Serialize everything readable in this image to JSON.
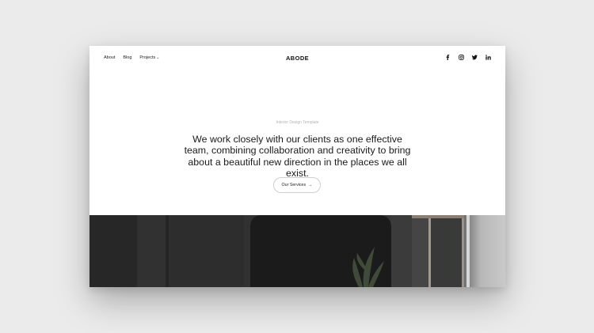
{
  "nav": {
    "items": [
      {
        "label": "About"
      },
      {
        "label": "Blog"
      },
      {
        "label": "Projects"
      }
    ],
    "projects_chevron": "chevron-down-icon",
    "logo": "ABODE",
    "socials": [
      "facebook-icon",
      "instagram-icon",
      "twitter-icon",
      "linkedin-icon"
    ]
  },
  "hero": {
    "eyebrow": "Interior Design Template",
    "headline": "We work closely with our clients as one effective team, combining collaboration and creativity to bring about a beautiful new direction in the places we all exist.",
    "cta_label": "Our Services",
    "cta_icon": "arrow-right-icon"
  },
  "colors": {
    "background": "#ebebeb",
    "page": "#ffffff",
    "text": "#1b1b1b",
    "muted": "#b5b5b5",
    "photo_dark": "#2a2b2a"
  }
}
